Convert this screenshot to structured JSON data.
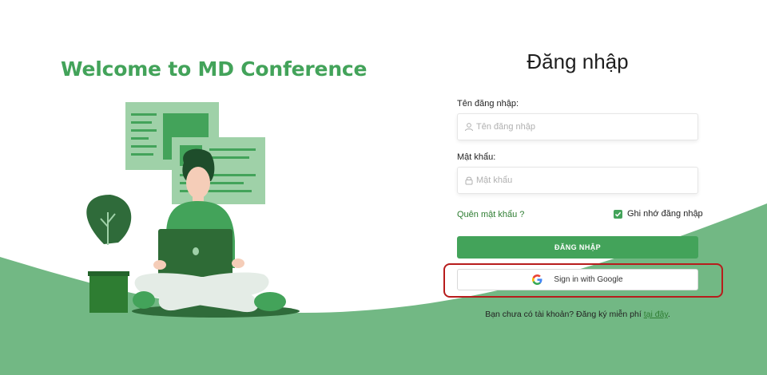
{
  "welcome": {
    "title": "Welcome to MD Conference"
  },
  "login": {
    "title": "Đăng nhập",
    "username_label": "Tên đăng nhập:",
    "username_placeholder": "Tên đăng nhập",
    "username_value": "",
    "password_label": "Mật khẩu:",
    "password_placeholder": "Mật khẩu",
    "password_value": "",
    "forgot_password": "Quên mật khẩu ?",
    "remember_me": "Ghi nhớ đăng nhập",
    "remember_me_checked": true,
    "submit_label": "ĐĂNG NHẬP",
    "google_label": "Sign in with Google",
    "signup_text": "Bạn chưa có tài khoản? Đăng ký miễn phí",
    "signup_link": "tại đây",
    "signup_suffix": "."
  },
  "icons": {
    "username": "user-icon",
    "password": "lock-icon",
    "google": "google-icon",
    "checkbox": "check-icon"
  },
  "colors": {
    "accent": "#43a35a",
    "wave": "#72b884",
    "link": "#2e7d32",
    "highlight_frame": "#b71c1c"
  }
}
